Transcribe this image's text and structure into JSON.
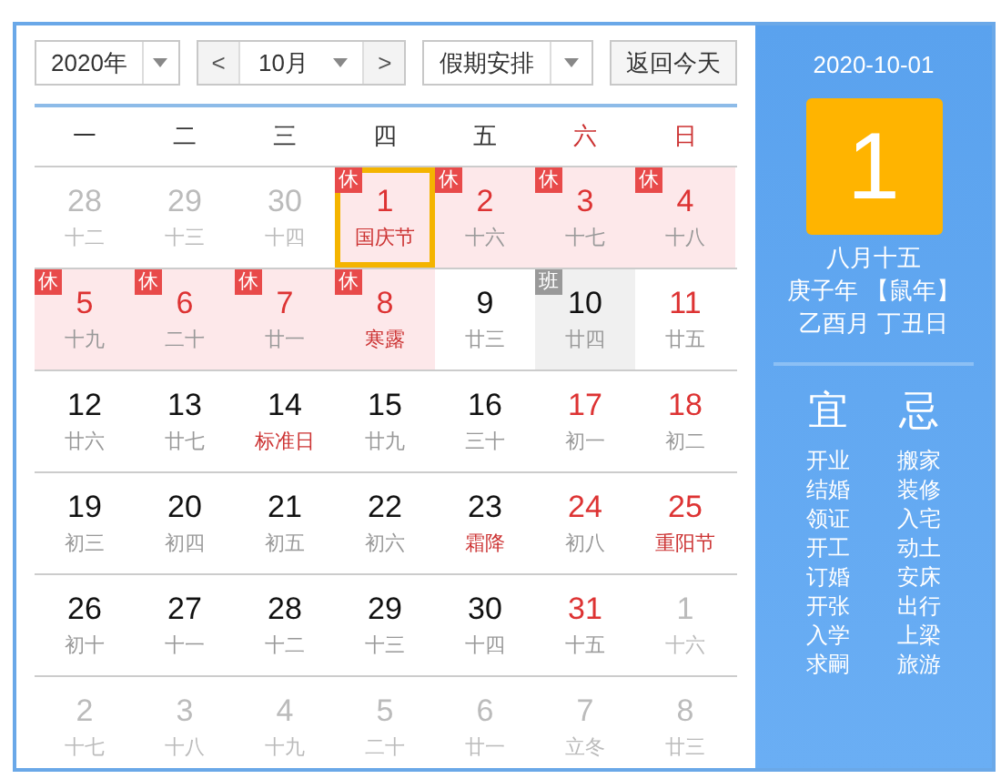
{
  "toolbar": {
    "year": "2020年",
    "prev": "<",
    "month": "10月",
    "next": ">",
    "holiday": "假期安排",
    "today_button": "返回今天"
  },
  "weekdays": [
    {
      "label": "一",
      "weekend": false
    },
    {
      "label": "二",
      "weekend": false
    },
    {
      "label": "三",
      "weekend": false
    },
    {
      "label": "四",
      "weekend": false
    },
    {
      "label": "五",
      "weekend": false
    },
    {
      "label": "六",
      "weekend": true
    },
    {
      "label": "日",
      "weekend": true
    }
  ],
  "weeks": [
    [
      {
        "day": "28",
        "sub": "十二",
        "other_month": true,
        "selected": false
      },
      {
        "day": "29",
        "sub": "十三",
        "other_month": true,
        "selected": false
      },
      {
        "day": "30",
        "sub": "十四",
        "other_month": true,
        "selected": false
      },
      {
        "day": "1",
        "sub": "国庆节",
        "other_month": false,
        "red": true,
        "sub_red": true,
        "selected": true,
        "badge": {
          "text": "休",
          "kind": "rest"
        }
      },
      {
        "day": "2",
        "sub": "十六",
        "other_month": false,
        "red": true,
        "sub_red": false,
        "selected": false,
        "badge": {
          "text": "休",
          "kind": "rest"
        }
      },
      {
        "day": "3",
        "sub": "十七",
        "other_month": false,
        "red": true,
        "sub_red": false,
        "selected": false,
        "badge": {
          "text": "休",
          "kind": "rest"
        }
      },
      {
        "day": "4",
        "sub": "十八",
        "other_month": false,
        "red": true,
        "sub_red": false,
        "selected": false,
        "badge": {
          "text": "休",
          "kind": "rest"
        }
      }
    ],
    [
      {
        "day": "5",
        "sub": "十九",
        "other_month": false,
        "red": true,
        "sub_red": false,
        "selected": false,
        "badge": {
          "text": "休",
          "kind": "rest"
        }
      },
      {
        "day": "6",
        "sub": "二十",
        "other_month": false,
        "red": true,
        "sub_red": false,
        "selected": false,
        "badge": {
          "text": "休",
          "kind": "rest"
        }
      },
      {
        "day": "7",
        "sub": "廿一",
        "other_month": false,
        "red": true,
        "sub_red": false,
        "selected": false,
        "badge": {
          "text": "休",
          "kind": "rest"
        }
      },
      {
        "day": "8",
        "sub": "寒露",
        "other_month": false,
        "red": true,
        "sub_red": true,
        "selected": false,
        "badge": {
          "text": "休",
          "kind": "rest"
        }
      },
      {
        "day": "9",
        "sub": "廿三",
        "other_month": false,
        "red": false,
        "sub_red": false,
        "selected": false
      },
      {
        "day": "10",
        "sub": "廿四",
        "other_month": false,
        "red": false,
        "sub_red": false,
        "selected": false,
        "badge": {
          "text": "班",
          "kind": "work"
        }
      },
      {
        "day": "11",
        "sub": "廿五",
        "other_month": false,
        "red": true,
        "sub_red": false,
        "selected": false
      }
    ],
    [
      {
        "day": "12",
        "sub": "廿六",
        "other_month": false,
        "red": false,
        "sub_red": false,
        "selected": false
      },
      {
        "day": "13",
        "sub": "廿七",
        "other_month": false,
        "red": false,
        "sub_red": false,
        "selected": false
      },
      {
        "day": "14",
        "sub": "标准日",
        "other_month": false,
        "red": false,
        "sub_red": true,
        "selected": false
      },
      {
        "day": "15",
        "sub": "廿九",
        "other_month": false,
        "red": false,
        "sub_red": false,
        "selected": false
      },
      {
        "day": "16",
        "sub": "三十",
        "other_month": false,
        "red": false,
        "sub_red": false,
        "selected": false
      },
      {
        "day": "17",
        "sub": "初一",
        "other_month": false,
        "red": true,
        "sub_red": false,
        "selected": false
      },
      {
        "day": "18",
        "sub": "初二",
        "other_month": false,
        "red": true,
        "sub_red": false,
        "selected": false
      }
    ],
    [
      {
        "day": "19",
        "sub": "初三",
        "other_month": false,
        "red": false,
        "sub_red": false,
        "selected": false
      },
      {
        "day": "20",
        "sub": "初四",
        "other_month": false,
        "red": false,
        "sub_red": false,
        "selected": false
      },
      {
        "day": "21",
        "sub": "初五",
        "other_month": false,
        "red": false,
        "sub_red": false,
        "selected": false
      },
      {
        "day": "22",
        "sub": "初六",
        "other_month": false,
        "red": false,
        "sub_red": false,
        "selected": false
      },
      {
        "day": "23",
        "sub": "霜降",
        "other_month": false,
        "red": false,
        "sub_red": true,
        "selected": false
      },
      {
        "day": "24",
        "sub": "初八",
        "other_month": false,
        "red": true,
        "sub_red": false,
        "selected": false
      },
      {
        "day": "25",
        "sub": "重阳节",
        "other_month": false,
        "red": true,
        "sub_red": true,
        "selected": false
      }
    ],
    [
      {
        "day": "26",
        "sub": "初十",
        "other_month": false,
        "red": false,
        "sub_red": false,
        "selected": false
      },
      {
        "day": "27",
        "sub": "十一",
        "other_month": false,
        "red": false,
        "sub_red": false,
        "selected": false
      },
      {
        "day": "28",
        "sub": "十二",
        "other_month": false,
        "red": false,
        "sub_red": false,
        "selected": false
      },
      {
        "day": "29",
        "sub": "十三",
        "other_month": false,
        "red": false,
        "sub_red": false,
        "selected": false
      },
      {
        "day": "30",
        "sub": "十四",
        "other_month": false,
        "red": false,
        "sub_red": false,
        "selected": false
      },
      {
        "day": "31",
        "sub": "十五",
        "other_month": false,
        "red": true,
        "sub_red": false,
        "selected": false
      },
      {
        "day": "1",
        "sub": "十六",
        "other_month": true,
        "selected": false
      }
    ],
    [
      {
        "day": "2",
        "sub": "十七",
        "other_month": true,
        "selected": false
      },
      {
        "day": "3",
        "sub": "十八",
        "other_month": true,
        "selected": false
      },
      {
        "day": "4",
        "sub": "十九",
        "other_month": true,
        "selected": false
      },
      {
        "day": "5",
        "sub": "二十",
        "other_month": true,
        "selected": false
      },
      {
        "day": "6",
        "sub": "廿一",
        "other_month": true,
        "selected": false
      },
      {
        "day": "7",
        "sub": "立冬",
        "other_month": true,
        "selected": false
      },
      {
        "day": "8",
        "sub": "廿三",
        "other_month": true,
        "selected": false
      }
    ]
  ],
  "detail": {
    "date": "2020-10-01",
    "day": "1",
    "lunar": [
      "八月十五",
      "庚子年 【鼠年】",
      "乙酉月 丁丑日"
    ],
    "yi": {
      "title": "宜",
      "items": [
        "开业",
        "结婚",
        "领证",
        "开工",
        "订婚",
        "开张",
        "入学",
        "求嗣"
      ]
    },
    "ji": {
      "title": "忌",
      "items": [
        "搬家",
        "装修",
        "入宅",
        "动土",
        "安床",
        "出行",
        "上梁",
        "旅游"
      ]
    }
  }
}
